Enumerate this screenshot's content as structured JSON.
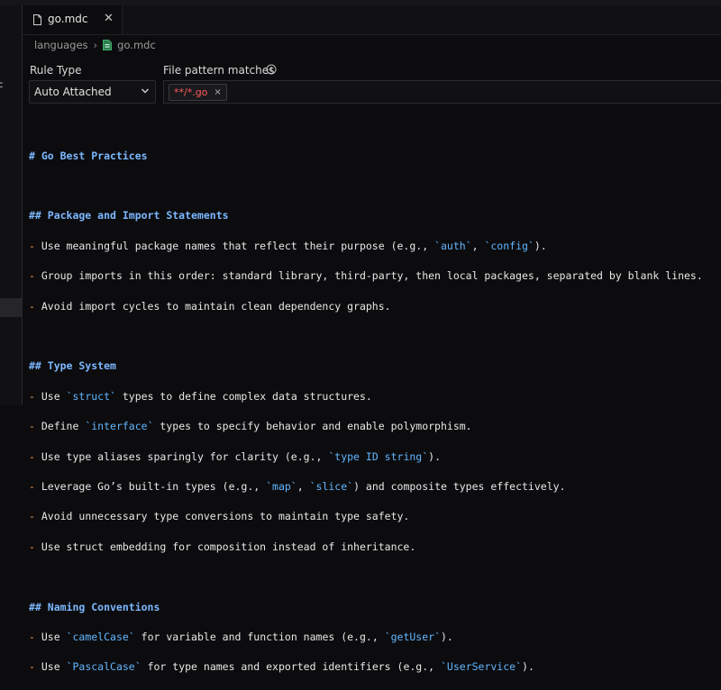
{
  "tab": {
    "label": "go.mdc"
  },
  "breadcrumb": {
    "folder": "languages",
    "file": "go.mdc"
  },
  "sidebar": {
    "fragment": "c"
  },
  "rule_type": {
    "label": "Rule Type",
    "value": "Auto Attached"
  },
  "file_pattern": {
    "label": "File pattern matches",
    "chip": "**/*.go",
    "remove": "×"
  },
  "content": {
    "title": "# Go Best Practices",
    "sec1": {
      "heading": "## Package and Import Statements",
      "b1": {
        "a": "Use meaningful package names that reflect their purpose (e.g., ",
        "c1": "`auth`",
        "b": ", ",
        "c2": "`config`",
        "c": ")."
      },
      "b2": "Group imports in this order: standard library, third-party, then local packages, separated by blank lines.",
      "b3": "Avoid import cycles to maintain clean dependency graphs."
    },
    "sec2": {
      "heading": "## Type System",
      "b1": {
        "a": "Use ",
        "c1": "`struct`",
        "b": " types to define complex data structures."
      },
      "b2": {
        "a": "Define ",
        "c1": "`interface`",
        "b": " types to specify behavior and enable polymorphism."
      },
      "b3": {
        "a": "Use type aliases sparingly for clarity (e.g., ",
        "c1": "`type ID string`",
        "b": ")."
      },
      "b4": {
        "a": "Leverage Go’s built-in types (e.g., ",
        "c1": "`map`",
        "b": ", ",
        "c2": "`slice`",
        "c": ") and composite types effectively."
      },
      "b5": "Avoid unnecessary type conversions to maintain type safety.",
      "b6": "Use struct embedding for composition instead of inheritance."
    },
    "sec3": {
      "heading": "## Naming Conventions",
      "b1": {
        "a": "Use ",
        "c1": "`camelCase`",
        "b": " for variable and function names (e.g., ",
        "c2": "`getUser`",
        "c": ")."
      },
      "b2": {
        "a": "Use ",
        "c1": "`PascalCase`",
        "b": " for type names and exported identifiers (e.g., ",
        "c2": "`UserService`",
        "c": ")."
      }
    }
  },
  "colors": {
    "heading": "#7cb8ff",
    "bullet": "#f29d5a",
    "inline_code": "#62b6ff",
    "chip_text": "#ff5c5c",
    "background": "#0c0c0e"
  }
}
